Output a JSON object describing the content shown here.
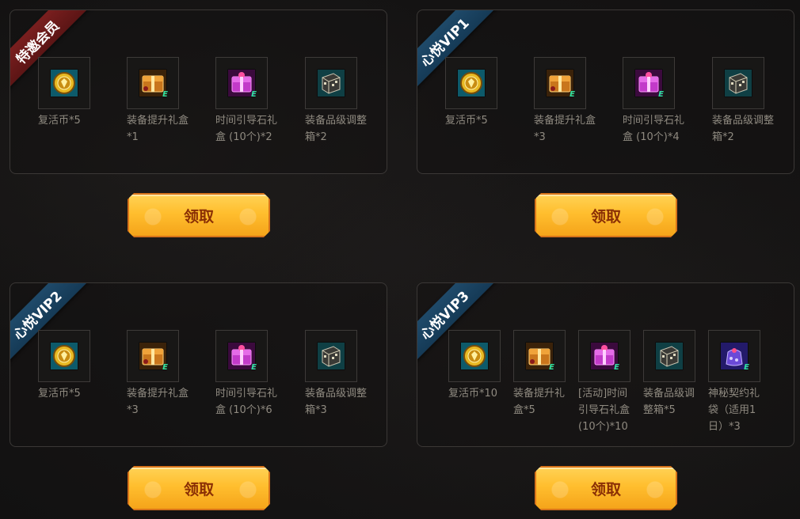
{
  "panels": [
    {
      "ribbon": "特邀会员",
      "items": [
        {
          "icon": "revive-coin-icon",
          "label": "复活币*5"
        },
        {
          "icon": "equipment-upgrade-box-icon",
          "label": "装备提升礼盒*1"
        },
        {
          "icon": "time-guide-stone-box-icon",
          "label": "时间引导石礼盒 (10个)*2"
        },
        {
          "icon": "equipment-grade-adjust-box-icon",
          "label": "装备品级调整箱*2"
        }
      ],
      "button": "领取"
    },
    {
      "ribbon": "心悦VIP1",
      "items": [
        {
          "icon": "revive-coin-icon",
          "label": "复活币*5"
        },
        {
          "icon": "equipment-upgrade-box-icon",
          "label": "装备提升礼盒*3"
        },
        {
          "icon": "time-guide-stone-box-icon",
          "label": "时间引导石礼盒 (10个)*4"
        },
        {
          "icon": "equipment-grade-adjust-box-icon",
          "label": "装备品级调整箱*2"
        }
      ],
      "button": "领取"
    },
    {
      "ribbon": "心悦VIP2",
      "items": [
        {
          "icon": "revive-coin-icon",
          "label": "复活币*5"
        },
        {
          "icon": "equipment-upgrade-box-icon",
          "label": "装备提升礼盒*3"
        },
        {
          "icon": "time-guide-stone-box-icon",
          "label": "时间引导石礼盒 (10个)*6"
        },
        {
          "icon": "equipment-grade-adjust-box-icon",
          "label": "装备品级调整箱*3"
        }
      ],
      "button": "领取"
    },
    {
      "ribbon": "心悦VIP3",
      "items": [
        {
          "icon": "revive-coin-icon",
          "label": "复活币*10"
        },
        {
          "icon": "equipment-upgrade-box-icon",
          "label": "装备提升礼盒*5"
        },
        {
          "icon": "time-guide-stone-box-icon",
          "label": "[活动]时间引导石礼盒(10个)*10"
        },
        {
          "icon": "equipment-grade-adjust-box-icon",
          "label": "装备品级调整箱*5"
        },
        {
          "icon": "mystery-contract-bag-icon",
          "label": "神秘契约礼袋（适用1日）*3"
        }
      ],
      "button": "领取"
    }
  ]
}
